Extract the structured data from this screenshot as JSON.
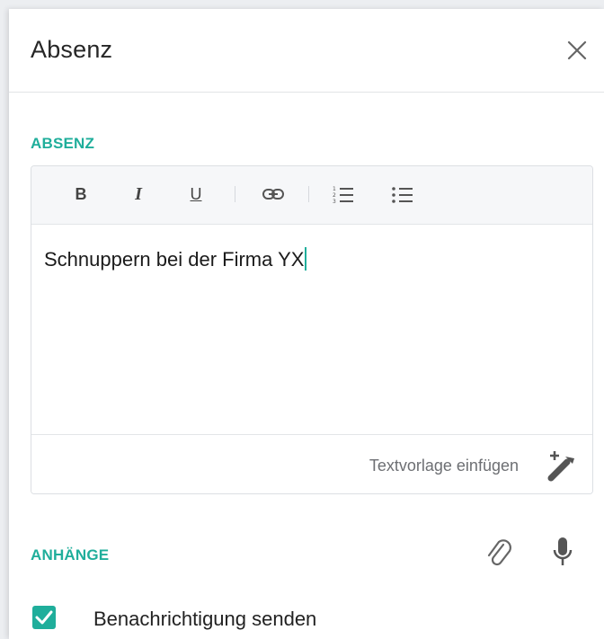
{
  "header": {
    "title": "Absenz"
  },
  "absence_section": {
    "label": "ABSENZ"
  },
  "editor": {
    "content": "Schnuppern bei der Firma YX",
    "toolbar": {
      "bold": "B",
      "italic": "I",
      "underline": "U"
    },
    "template_label": "Textvorlage einfügen"
  },
  "attachments": {
    "label": "ANHÄNGE"
  },
  "notification": {
    "label": "Benachrichtigung senden",
    "checked": true
  },
  "colors": {
    "accent": "#1fae9b"
  }
}
